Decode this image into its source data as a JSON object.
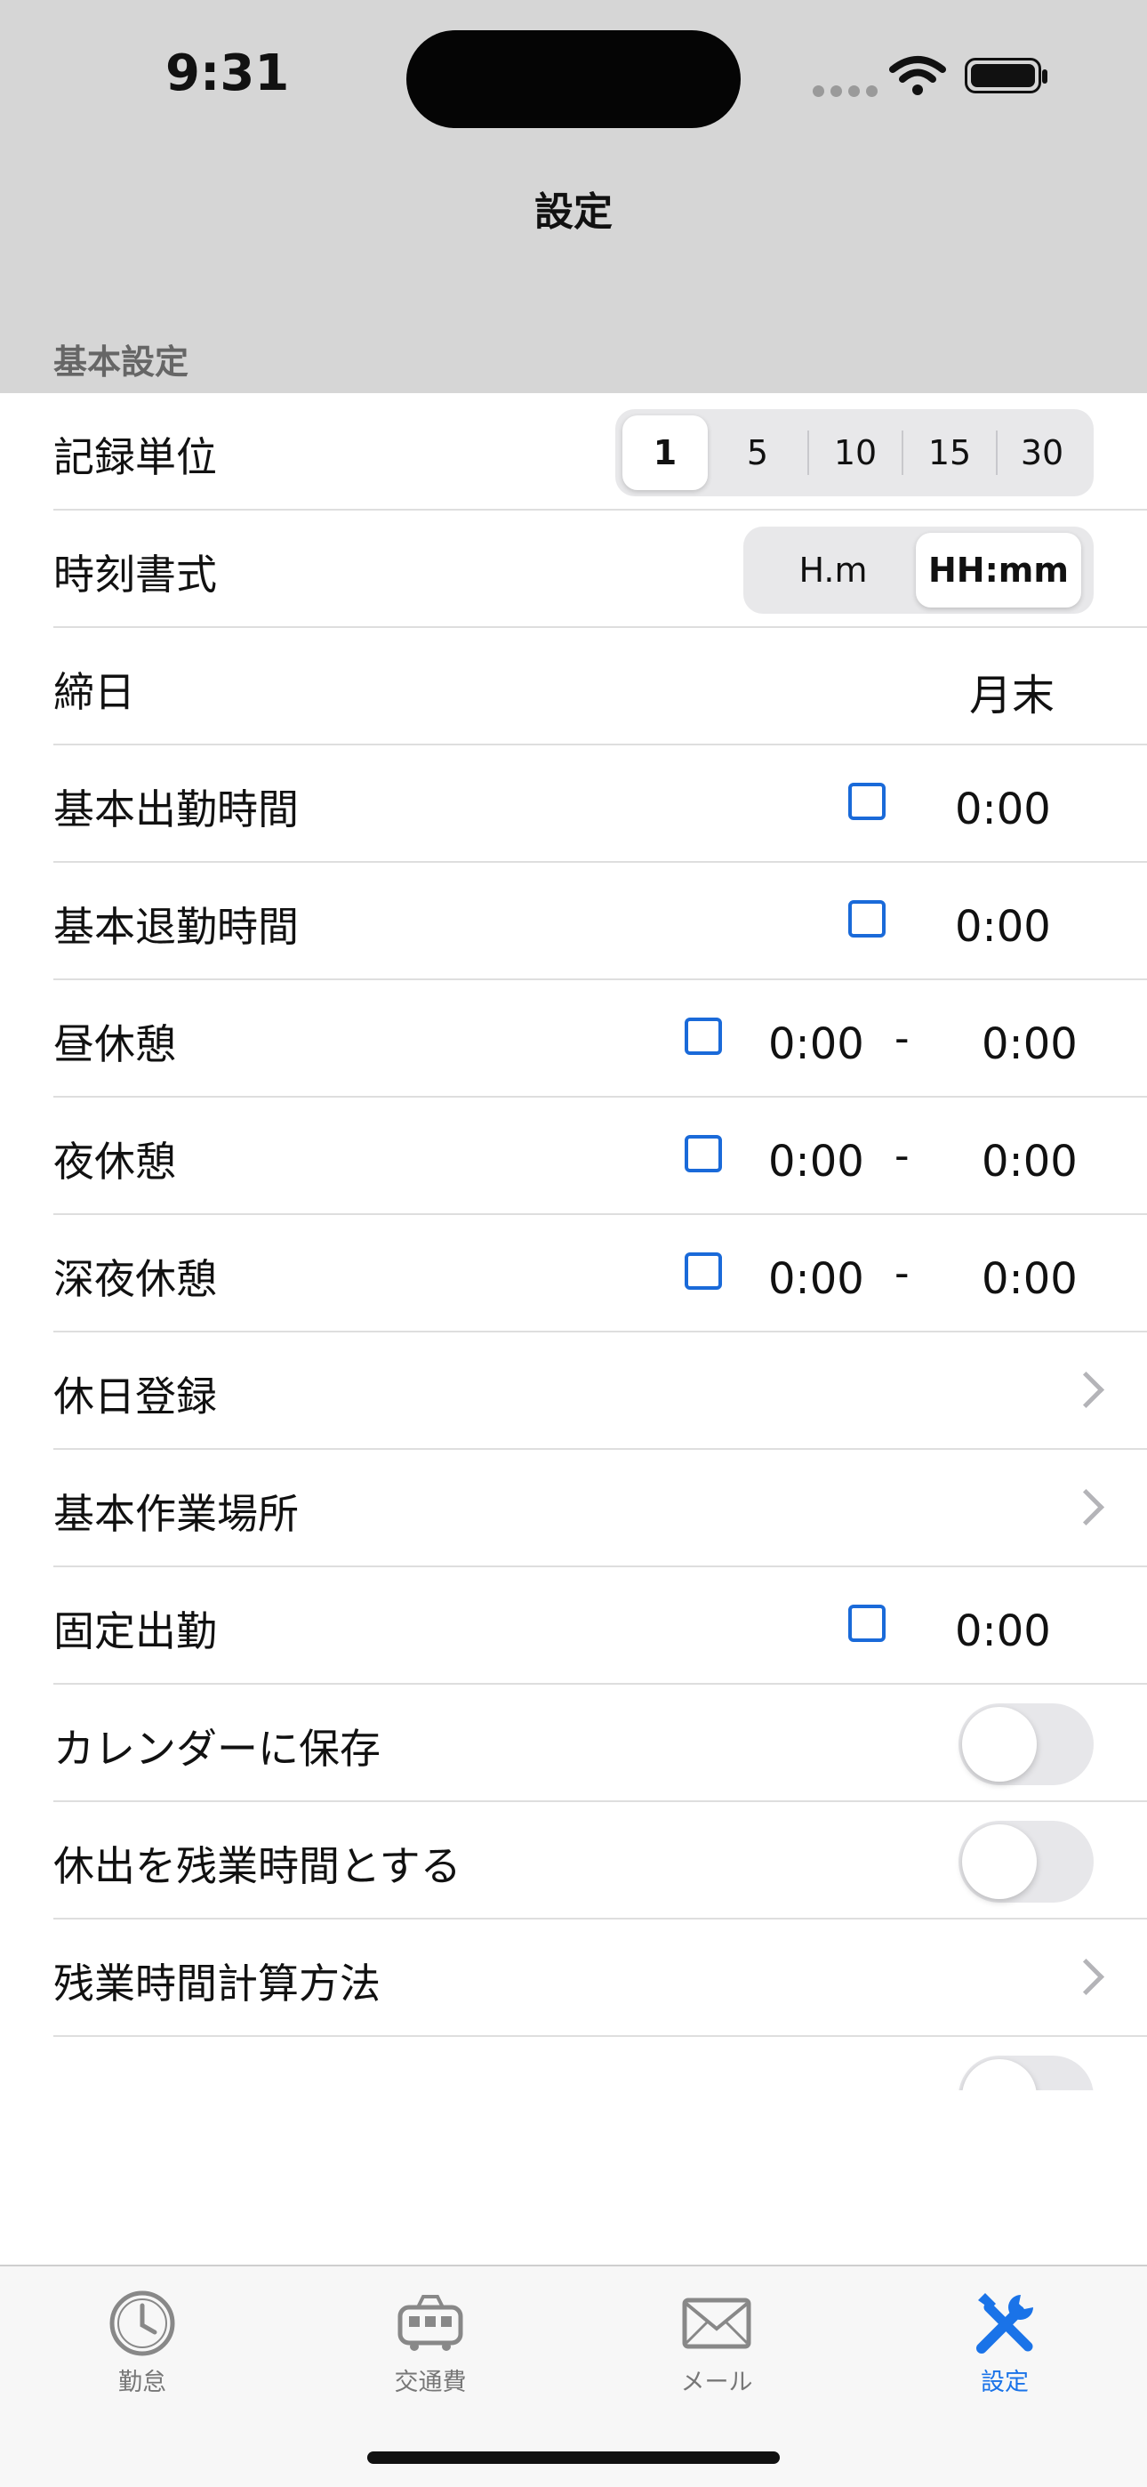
{
  "status_bar": {
    "time": "9:31"
  },
  "nav": {
    "title": "設定"
  },
  "section": {
    "title": "基本設定"
  },
  "rows": {
    "record_unit": {
      "label": "記録単位",
      "options": [
        "1",
        "5",
        "10",
        "15",
        "30"
      ],
      "selected": "1"
    },
    "time_format": {
      "label": "時刻書式",
      "options": [
        "H.m",
        "HH:mm"
      ],
      "selected": "HH:mm"
    },
    "closing_day": {
      "label": "締日",
      "value": "月末"
    },
    "basic_start": {
      "label": "基本出勤時間",
      "value": "0:00"
    },
    "basic_end": {
      "label": "基本退勤時間",
      "value": "0:00"
    },
    "lunch_break": {
      "label": "昼休憩",
      "from": "0:00",
      "sep": "-",
      "to": "0:00"
    },
    "night_break": {
      "label": "夜休憩",
      "from": "0:00",
      "sep": "-",
      "to": "0:00"
    },
    "late_night_break": {
      "label": "深夜休憩",
      "from": "0:00",
      "sep": "-",
      "to": "0:00"
    },
    "holiday_registration": {
      "label": "休日登録"
    },
    "basic_workplace": {
      "label": "基本作業場所"
    },
    "fixed_attendance": {
      "label": "固定出勤",
      "value": "0:00"
    },
    "save_to_calendar": {
      "label": "カレンダーに保存",
      "on": false
    },
    "holiday_as_overtime": {
      "label": "休出を残業時間とする",
      "on": false
    },
    "overtime_calc": {
      "label": "残業時間計算方法"
    }
  },
  "tabs": [
    {
      "label": "勤怠",
      "icon": "clock-icon"
    },
    {
      "label": "交通費",
      "icon": "train-icon"
    },
    {
      "label": "メール",
      "icon": "mail-icon"
    },
    {
      "label": "設定",
      "icon": "tools-icon",
      "active": true
    }
  ],
  "colors": {
    "accent": "#1a73e8",
    "checkbox": "#1a6ad9",
    "header_bg": "#d6d6d6"
  }
}
